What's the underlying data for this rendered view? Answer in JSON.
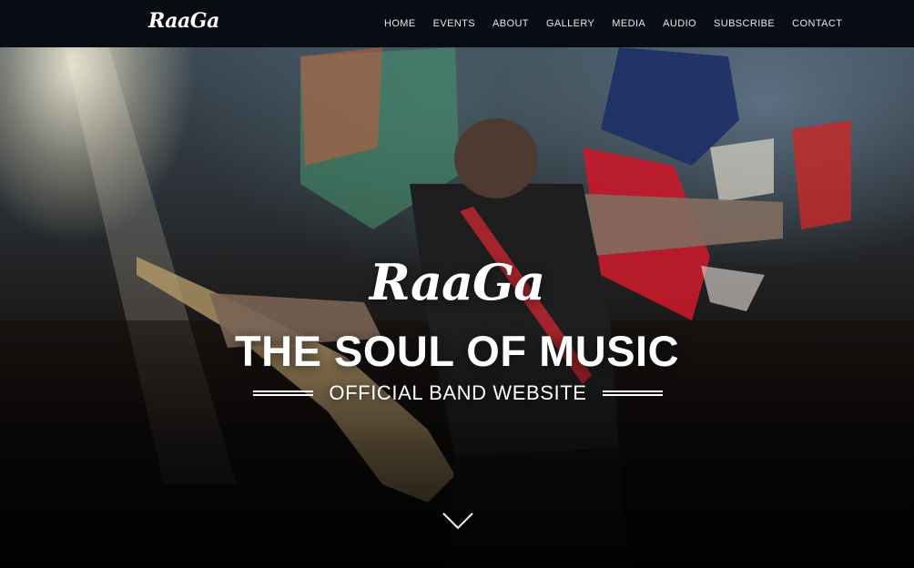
{
  "nav": {
    "logo": "RaaGa",
    "items": [
      {
        "label": "HOME"
      },
      {
        "label": "EVENTS"
      },
      {
        "label": "ABOUT"
      },
      {
        "label": "GALLERY"
      },
      {
        "label": "MEDIA"
      },
      {
        "label": "AUDIO"
      },
      {
        "label": "SUBSCRIBE"
      },
      {
        "label": "CONTACT"
      }
    ]
  },
  "hero": {
    "logo": "RaaGa",
    "headline": "THE SOUL OF MUSIC",
    "subtitle": "OFFICIAL BAND WEBSITE",
    "scroll_icon": "chevron-down-icon"
  },
  "colors": {
    "nav_background": "#0a0c14",
    "text": "#ffffff",
    "flag_red": "#c81a2a",
    "flag_navy": "#1d2f66"
  }
}
